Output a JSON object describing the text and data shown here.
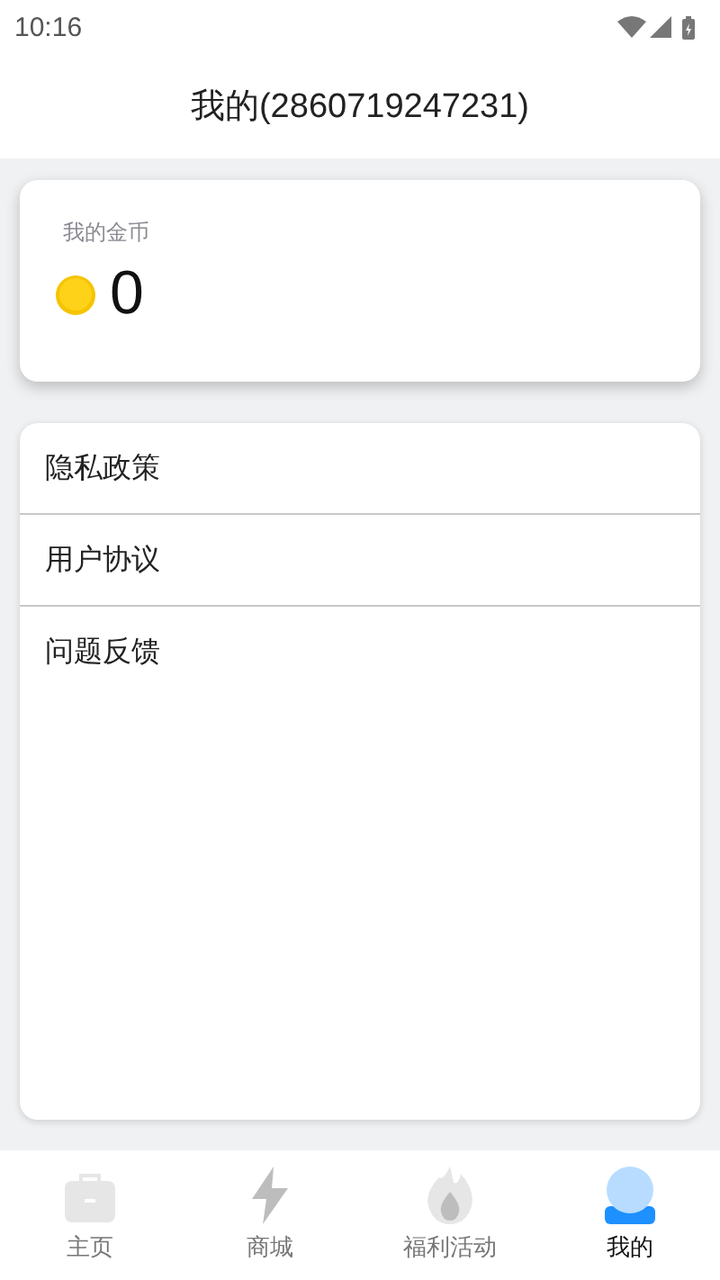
{
  "status_bar": {
    "time": "10:16"
  },
  "header": {
    "title": "我的(2860719247231)"
  },
  "coins": {
    "label": "我的金币",
    "amount": "0"
  },
  "menu": [
    {
      "label": "隐私政策"
    },
    {
      "label": "用户协议"
    },
    {
      "label": "问题反馈"
    }
  ],
  "tabs": [
    {
      "label": "主页",
      "kind": "home",
      "selected": false
    },
    {
      "label": "商城",
      "kind": "shop",
      "selected": false
    },
    {
      "label": "福利活动",
      "kind": "rewards",
      "selected": false
    },
    {
      "label": "我的",
      "kind": "profile",
      "selected": true
    }
  ]
}
